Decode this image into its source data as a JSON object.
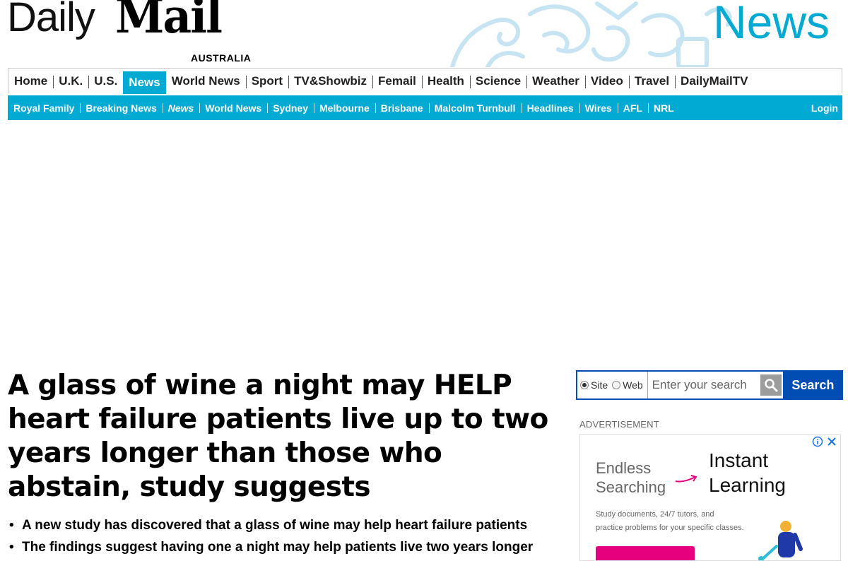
{
  "masthead": {
    "logo_daily": "Daily",
    "logo_mail": "Mail",
    "logo_sub": "AUSTRALIA",
    "section_title": "News"
  },
  "nav_primary": [
    {
      "label": "Home"
    },
    {
      "label": "U.K."
    },
    {
      "label": "U.S."
    },
    {
      "label": "News",
      "active": true
    },
    {
      "label": "World News"
    },
    {
      "label": "Sport"
    },
    {
      "label": "TV&Showbiz"
    },
    {
      "label": "Femail"
    },
    {
      "label": "Health"
    },
    {
      "label": "Science"
    },
    {
      "label": "Weather"
    },
    {
      "label": "Video"
    },
    {
      "label": "Travel"
    },
    {
      "label": "DailyMailTV"
    }
  ],
  "nav_secondary": [
    {
      "label": "Royal Family"
    },
    {
      "label": "Breaking News"
    },
    {
      "label": "News",
      "italic": true
    },
    {
      "label": "World News"
    },
    {
      "label": "Sydney"
    },
    {
      "label": "Melbourne"
    },
    {
      "label": "Brisbane"
    },
    {
      "label": "Malcolm Turnbull"
    },
    {
      "label": "Headlines"
    },
    {
      "label": "Wires"
    },
    {
      "label": "AFL"
    },
    {
      "label": "NRL"
    }
  ],
  "login_label": "Login",
  "article": {
    "headline": "A glass of wine a night may HELP heart failure patients live up to two years longer than those who abstain, study suggests",
    "bullets": [
      "A new study has discovered that a glass of wine may help heart failure patients",
      "The findings suggest having one a night may help patients live two years longer"
    ]
  },
  "search": {
    "option_site": "Site",
    "option_web": "Web",
    "selected": "Site",
    "placeholder": "Enter your search",
    "button_label": "Search"
  },
  "advertisement_label": "ADVERTISEMENT",
  "ad": {
    "left_line1": "Endless",
    "left_line2": "Searching",
    "right_line1": "Instant",
    "right_line2": "Learning",
    "small_line1": "Study documents, 24/7 tutors, and",
    "small_line2": "practice problems for your specific classes."
  },
  "colors": {
    "brand_cyan": "#00aad2",
    "search_blue": "#004db3",
    "ad_magenta": "#e6007e"
  }
}
